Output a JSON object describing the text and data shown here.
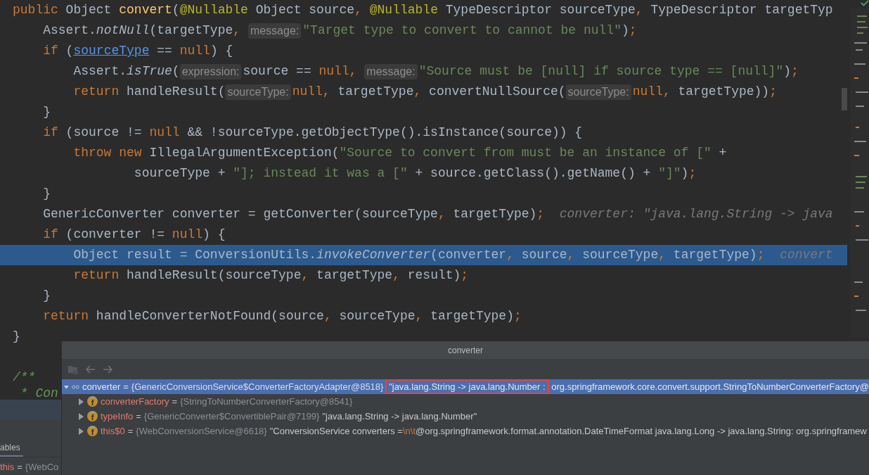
{
  "editor": {
    "lines": [
      {
        "current": false,
        "tokens": [
          {
            "kind": "keyword",
            "text": "public"
          },
          {
            "kind": "plain",
            "text": " Object "
          },
          {
            "kind": "declaration",
            "text": "convert"
          },
          {
            "kind": "plain",
            "text": "("
          },
          {
            "kind": "annotation",
            "text": "@Nullable"
          },
          {
            "kind": "plain",
            "text": " Object source"
          },
          {
            "kind": "punct",
            "text": ", "
          },
          {
            "kind": "annotation",
            "text": "@Nullable"
          },
          {
            "kind": "plain",
            "text": " TypeDescriptor sourceType"
          },
          {
            "kind": "punct",
            "text": ","
          },
          {
            "kind": "plain",
            "text": " TypeDescriptor targetTyp"
          }
        ]
      },
      {
        "current": false,
        "tokens": [
          {
            "kind": "plain",
            "text": "    Assert."
          },
          {
            "kind": "static",
            "text": "notNull"
          },
          {
            "kind": "plain",
            "text": "(targetType"
          },
          {
            "kind": "punct",
            "text": ", "
          },
          {
            "kind": "hint",
            "text": "message:"
          },
          {
            "kind": "string",
            "text": "\"Target type to convert to cannot be null\""
          },
          {
            "kind": "plain",
            "text": ")"
          },
          {
            "kind": "punct",
            "text": ";"
          }
        ]
      },
      {
        "current": false,
        "tokens": [
          {
            "kind": "keyword",
            "text": "    if"
          },
          {
            "kind": "plain",
            "text": " ("
          },
          {
            "kind": "link",
            "text": "sourceType"
          },
          {
            "kind": "plain",
            "text": " == "
          },
          {
            "kind": "keyword",
            "text": "null"
          },
          {
            "kind": "plain",
            "text": ") {"
          }
        ]
      },
      {
        "current": false,
        "tokens": [
          {
            "kind": "plain",
            "text": "        Assert."
          },
          {
            "kind": "static",
            "text": "isTrue"
          },
          {
            "kind": "plain",
            "text": "("
          },
          {
            "kind": "hint",
            "text": "expression:"
          },
          {
            "kind": "plain",
            "text": "source == "
          },
          {
            "kind": "keyword",
            "text": "null"
          },
          {
            "kind": "punct",
            "text": ", "
          },
          {
            "kind": "hint",
            "text": "message:"
          },
          {
            "kind": "string",
            "text": "\"Source must be [null] if source type == [null]\""
          },
          {
            "kind": "plain",
            "text": ")"
          },
          {
            "kind": "punct",
            "text": ";"
          }
        ]
      },
      {
        "current": false,
        "tokens": [
          {
            "kind": "keyword",
            "text": "        return"
          },
          {
            "kind": "plain",
            "text": " handleResult("
          },
          {
            "kind": "hint",
            "text": "sourceType:"
          },
          {
            "kind": "keyword",
            "text": "null"
          },
          {
            "kind": "punct",
            "text": ","
          },
          {
            "kind": "plain",
            "text": " targetType"
          },
          {
            "kind": "punct",
            "text": ","
          },
          {
            "kind": "plain",
            "text": " convertNullSource("
          },
          {
            "kind": "hint",
            "text": "sourceType:"
          },
          {
            "kind": "keyword",
            "text": "null"
          },
          {
            "kind": "punct",
            "text": ","
          },
          {
            "kind": "plain",
            "text": " targetType))"
          },
          {
            "kind": "punct",
            "text": ";"
          }
        ]
      },
      {
        "current": false,
        "tokens": [
          {
            "kind": "plain",
            "text": "    }"
          }
        ]
      },
      {
        "current": false,
        "tokens": [
          {
            "kind": "keyword",
            "text": "    if"
          },
          {
            "kind": "plain",
            "text": " (source != "
          },
          {
            "kind": "keyword",
            "text": "null"
          },
          {
            "kind": "plain",
            "text": " && !sourceType.getObjectType().isInstance(source)) {"
          }
        ]
      },
      {
        "current": false,
        "tokens": [
          {
            "kind": "keyword",
            "text": "        throw new"
          },
          {
            "kind": "plain",
            "text": " IllegalArgumentException("
          },
          {
            "kind": "string",
            "text": "\"Source to convert from must be an instance of [\""
          },
          {
            "kind": "plain",
            "text": " +"
          }
        ]
      },
      {
        "current": false,
        "tokens": [
          {
            "kind": "plain",
            "text": "                sourceType + "
          },
          {
            "kind": "string",
            "text": "\"]; instead it was a [\""
          },
          {
            "kind": "plain",
            "text": " + source.getClass().getName() + "
          },
          {
            "kind": "string",
            "text": "\"]\""
          },
          {
            "kind": "plain",
            "text": ")"
          },
          {
            "kind": "punct",
            "text": ";"
          }
        ]
      },
      {
        "current": false,
        "tokens": [
          {
            "kind": "plain",
            "text": "    }"
          }
        ]
      },
      {
        "current": false,
        "tokens": [
          {
            "kind": "plain",
            "text": "    GenericConverter converter = getConverter(sourceType"
          },
          {
            "kind": "punct",
            "text": ","
          },
          {
            "kind": "plain",
            "text": " targetType)"
          },
          {
            "kind": "punct",
            "text": ";  "
          },
          {
            "kind": "value",
            "text": "converter: \"java.lang.String -> java"
          }
        ]
      },
      {
        "current": false,
        "tokens": [
          {
            "kind": "keyword",
            "text": "    if"
          },
          {
            "kind": "plain",
            "text": " (converter != "
          },
          {
            "kind": "keyword",
            "text": "null"
          },
          {
            "kind": "plain",
            "text": ") {"
          }
        ]
      },
      {
        "current": true,
        "tokens": [
          {
            "kind": "plain",
            "text": "        Object result = ConversionUtils."
          },
          {
            "kind": "static",
            "text": "invokeConverter"
          },
          {
            "kind": "plain",
            "text": "(converter"
          },
          {
            "kind": "punct",
            "text": ","
          },
          {
            "kind": "plain",
            "text": " source"
          },
          {
            "kind": "punct",
            "text": ","
          },
          {
            "kind": "plain",
            "text": " sourceType"
          },
          {
            "kind": "punct",
            "text": ","
          },
          {
            "kind": "plain",
            "text": " targetType)"
          },
          {
            "kind": "punct",
            "text": ";  "
          },
          {
            "kind": "value",
            "text": "convert"
          }
        ]
      },
      {
        "current": false,
        "tokens": [
          {
            "kind": "keyword",
            "text": "        return"
          },
          {
            "kind": "plain",
            "text": " handleResult(sourceType"
          },
          {
            "kind": "punct",
            "text": ","
          },
          {
            "kind": "plain",
            "text": " targetType"
          },
          {
            "kind": "punct",
            "text": ","
          },
          {
            "kind": "plain",
            "text": " result)"
          },
          {
            "kind": "punct",
            "text": ";"
          }
        ]
      },
      {
        "current": false,
        "tokens": [
          {
            "kind": "plain",
            "text": "    }"
          }
        ]
      },
      {
        "current": false,
        "tokens": [
          {
            "kind": "keyword",
            "text": "    return"
          },
          {
            "kind": "plain",
            "text": " handleConverterNotFound(source"
          },
          {
            "kind": "punct",
            "text": ","
          },
          {
            "kind": "plain",
            "text": " sourceType"
          },
          {
            "kind": "punct",
            "text": ","
          },
          {
            "kind": "plain",
            "text": " targetType)"
          },
          {
            "kind": "punct",
            "text": ";"
          }
        ]
      },
      {
        "current": false,
        "tokens": [
          {
            "kind": "plain",
            "text": "}"
          }
        ]
      },
      {
        "current": false
      },
      {
        "current": false,
        "tokens": [
          {
            "kind": "doc",
            "text": "/**"
          }
        ]
      },
      {
        "current": false,
        "tokens": [
          {
            "kind": "doc",
            "text": " * Con"
          }
        ]
      }
    ]
  },
  "debug_panel": {
    "tab": "ables",
    "variables": [
      {
        "name": "this",
        "operator": "=",
        "type": "{WebCo"
      }
    ]
  },
  "popup": {
    "title": "converter",
    "tree": [
      {
        "kind": "watch",
        "name": "converter",
        "operator": "=",
        "type": "{GenericConversionService$ConverterFactoryAdapter@8518}",
        "expanded": true,
        "selected": true,
        "value_parts": [
          {
            "kind": "boxed",
            "text": "\"java.lang.String -> java.lang.Number :"
          },
          {
            "kind": "plain",
            "text": " org.springframework.core.convert.support.StringToNumberConverterFactory@"
          }
        ],
        "children": [
          {
            "kind": "field",
            "badge": "f",
            "name": "converterFactory",
            "operator": "=",
            "type": "{StringToNumberConverterFactory@8541}",
            "expanded": false,
            "selected": false
          },
          {
            "kind": "field",
            "badge": "f",
            "name": "typeInfo",
            "operator": "=",
            "type": "{GenericConverter$ConvertiblePair@7199}",
            "expanded": false,
            "selected": false,
            "value_parts": [
              {
                "kind": "plain",
                "text": "\"java.lang.String -> java.lang.Number\""
              }
            ]
          },
          {
            "kind": "field",
            "badge": "f",
            "name": "this$0",
            "operator": "=",
            "type": "{WebConversionService@6618}",
            "expanded": false,
            "selected": false,
            "value_parts": [
              {
                "kind": "plain",
                "text": "\"ConversionService converters ="
              },
              {
                "kind": "escape",
                "text": "\\n\\t"
              },
              {
                "kind": "plain",
                "text": "@org.springframework.format.annotation.DateTimeFormat java.lang.Long -> java.lang.String: org.springframew"
              }
            ]
          }
        ]
      }
    ]
  }
}
